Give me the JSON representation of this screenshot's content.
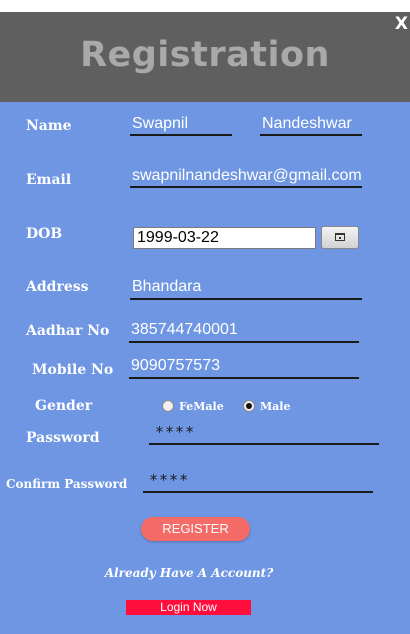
{
  "window": {
    "title": "Registration",
    "close_label": "X"
  },
  "colors": {
    "header_bg": "#5f5f5f",
    "panel_bg": "#6f96e3",
    "register_button": "#f56b68",
    "login_button": "#ff0e3d"
  },
  "form": {
    "name_label": "Name",
    "first_name": "Swapnil",
    "last_name": "Nandeshwar",
    "email_label": "Email",
    "email": "swapnilnandeshwar@gmail.com",
    "dob_label": "DOB",
    "dob": "1999-03-22",
    "calendar_icon": "calendar-icon",
    "address_label": "Address",
    "address": "Bhandara",
    "aadhar_label": "Aadhar No",
    "aadhar": "385744740001",
    "mobile_label": "Mobile No",
    "mobile": "9090757573",
    "gender_label": "Gender",
    "gender_options": [
      "FeMale",
      "Male"
    ],
    "gender_selected": "Male",
    "password_label": "Password",
    "password": "****",
    "confirm_label": "Confirm Password",
    "confirm_password": "****"
  },
  "actions": {
    "register_label": "REGISTER",
    "already_text": "Already Have A Account?",
    "login_label": "Login Now"
  }
}
